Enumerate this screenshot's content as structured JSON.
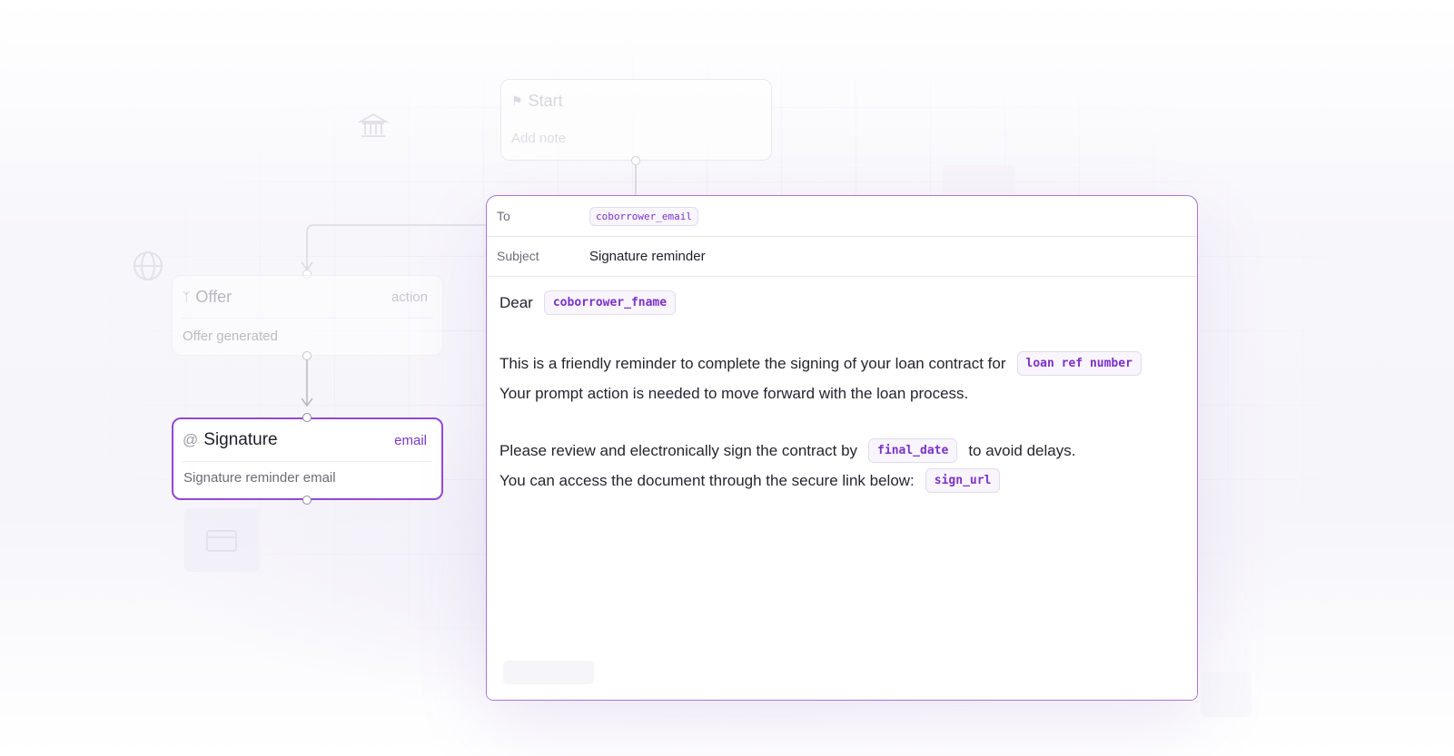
{
  "canvas": {
    "nodes": {
      "start": {
        "title": "Start",
        "note": "Add note",
        "icon": "flag-icon"
      },
      "offer": {
        "title": "Offer",
        "tag": "action",
        "note": "Offer generated",
        "icon": "branch-icon"
      },
      "signature": {
        "title": "Signature",
        "tag": "email",
        "note": "Signature reminder email",
        "icon": "at-icon"
      }
    }
  },
  "email": {
    "to_label": "To",
    "to_value": "coborrower_email",
    "subject_label": "Subject",
    "subject_value": "Signature reminder",
    "body": {
      "greeting": "Dear",
      "greeting_var": "coborrower_fname",
      "line1": "This is a friendly reminder to complete the signing of your loan contract for",
      "line1_var": "loan ref number",
      "line2": "Your prompt action is needed to move forward with the loan process.",
      "line3_pre": "Please review and electronically sign the contract by",
      "line3_var": "final_date",
      "line3_post": "to avoid delays.",
      "line4": "You can access the document through the secure link below:",
      "line4_var": "sign_url"
    }
  },
  "colors": {
    "accent": "#9348d4",
    "accent_text": "#7d31c9",
    "chip_bg": "#f8f5fc"
  }
}
